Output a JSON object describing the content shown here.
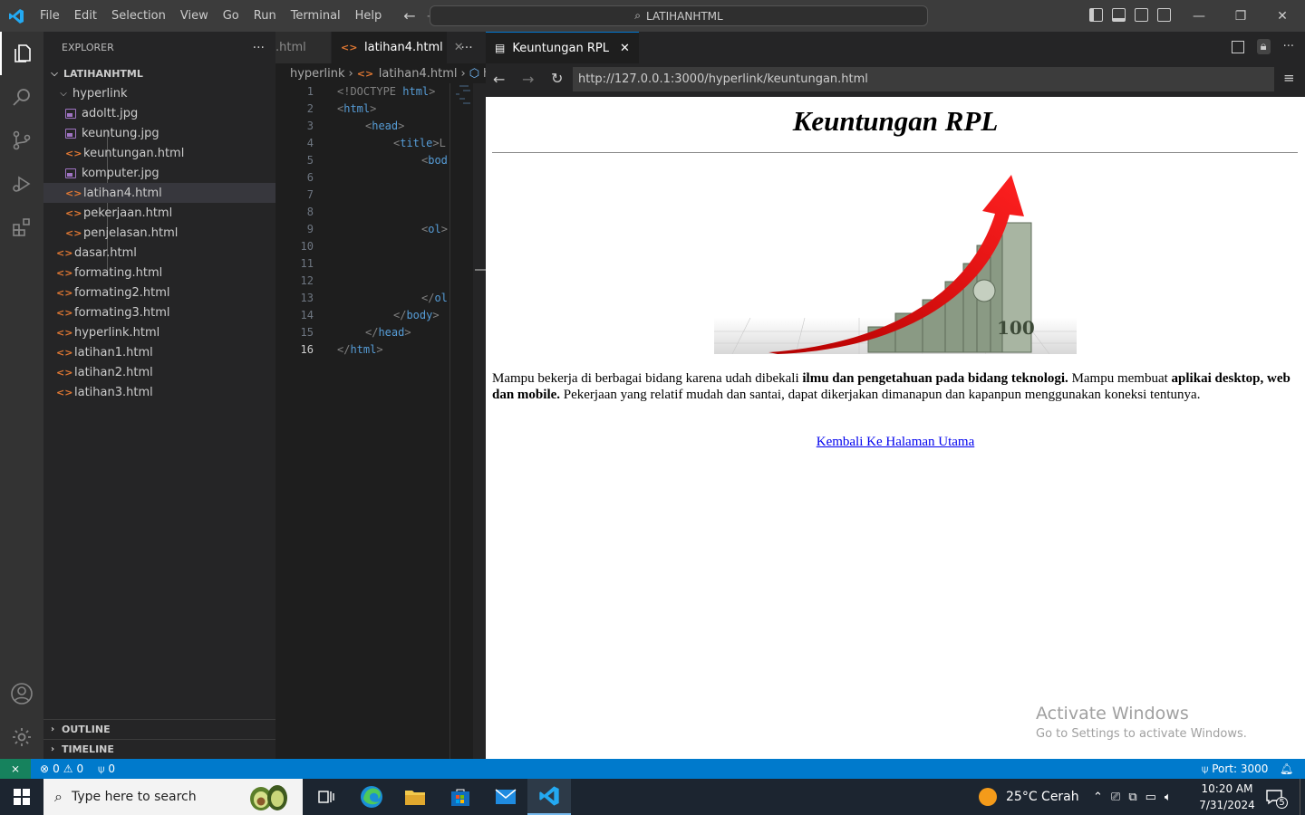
{
  "titlebar": {
    "menu": [
      "File",
      "Edit",
      "Selection",
      "View",
      "Go",
      "Run",
      "Terminal",
      "Help"
    ],
    "search": "LATIHANHTML"
  },
  "sidebar": {
    "title": "EXPLORER",
    "root": "LATIHANHTML",
    "folder": "hyperlink",
    "folder_items": [
      {
        "name": "adoltt.jpg",
        "type": "image"
      },
      {
        "name": "keuntung.jpg",
        "type": "image"
      },
      {
        "name": "keuntungan.html",
        "type": "html"
      },
      {
        "name": "komputer.jpg",
        "type": "image"
      },
      {
        "name": "latihan4.html",
        "type": "html",
        "selected": true
      },
      {
        "name": "pekerjaan.html",
        "type": "html"
      },
      {
        "name": "penjelasan.html",
        "type": "html"
      }
    ],
    "root_items": [
      "dasar.html",
      "formating.html",
      "formating2.html",
      "formating3.html",
      "hyperlink.html",
      "latihan1.html",
      "latihan2.html",
      "latihan3.html"
    ],
    "outline": "OUTLINE",
    "timeline": "TIMELINE"
  },
  "editor": {
    "tabs": [
      ".html",
      "latihan4.html"
    ],
    "breadcrumb": [
      "hyperlink",
      "latihan4.html",
      "htr"
    ],
    "current_line": 16,
    "lines": [
      {
        "n": "1",
        "indent": 0,
        "open": "<!DOCTYPE ",
        "tag": "html",
        "close": ">"
      },
      {
        "n": "2",
        "indent": 0,
        "open": "<",
        "tag": "html",
        "close": ">"
      },
      {
        "n": "3",
        "indent": 1,
        "open": "<",
        "tag": "head",
        "close": ">"
      },
      {
        "n": "4",
        "indent": 2,
        "open": "<",
        "tag": "title",
        "close": ">L"
      },
      {
        "n": "5",
        "indent": 3,
        "open": "<",
        "tag": "bod",
        "close": ""
      },
      {
        "n": "6",
        "indent": 0,
        "open": "",
        "tag": "",
        "close": ""
      },
      {
        "n": "7",
        "indent": 0,
        "open": "",
        "tag": "",
        "close": ""
      },
      {
        "n": "8",
        "indent": 0,
        "open": "",
        "tag": "",
        "close": ""
      },
      {
        "n": "9",
        "indent": 3,
        "open": "<",
        "tag": "ol",
        "close": ">"
      },
      {
        "n": "10",
        "indent": 0,
        "open": "",
        "tag": "",
        "close": ""
      },
      {
        "n": "11",
        "indent": 0,
        "open": "",
        "tag": "",
        "close": ""
      },
      {
        "n": "12",
        "indent": 0,
        "open": "",
        "tag": "",
        "close": ""
      },
      {
        "n": "13",
        "indent": 3,
        "open": "</",
        "tag": "ol",
        "close": ""
      },
      {
        "n": "14",
        "indent": 2,
        "open": "</",
        "tag": "body",
        "close": ">"
      },
      {
        "n": "15",
        "indent": 1,
        "open": "</",
        "tag": "head",
        "close": ">"
      },
      {
        "n": "16",
        "indent": 0,
        "open": "</",
        "tag": "html",
        "close": ">"
      }
    ]
  },
  "preview": {
    "tab": "Keuntungan RPL",
    "url": "http://127.0.0.1:3000/hyperlink/keuntungan.html",
    "heading": "Keuntungan RPL",
    "image_text": "100",
    "para_1": "Mampu bekerja di berbagai bidang karena udah dibekali ",
    "para_bold_1": "ilmu dan pengetahuan pada bidang teknologi.",
    "para_2": " Mampu membuat ",
    "para_bold_2": "aplikai desktop, web dan mobile.",
    "para_3": " Pekerjaan yang relatif mudah dan santai, dapat dikerjakan dimanapun dan kapanpun menggunakan koneksi tentunya.",
    "link": "Kembali Ke Halaman Utama",
    "watermark_title": "Activate Windows",
    "watermark_sub": "Go to Settings to activate Windows."
  },
  "statusbar": {
    "errors": "0",
    "warnings": "0",
    "ports": "0",
    "port_label": "Port: 3000"
  },
  "taskbar": {
    "search_placeholder": "Type here to search",
    "weather": "25°C  Cerah",
    "time": "10:20 AM",
    "date": "7/31/2024",
    "notifications": "5"
  },
  "colors": {
    "accent": "#007acc",
    "html_icon": "#e37933",
    "image_icon": "#a074c4"
  }
}
